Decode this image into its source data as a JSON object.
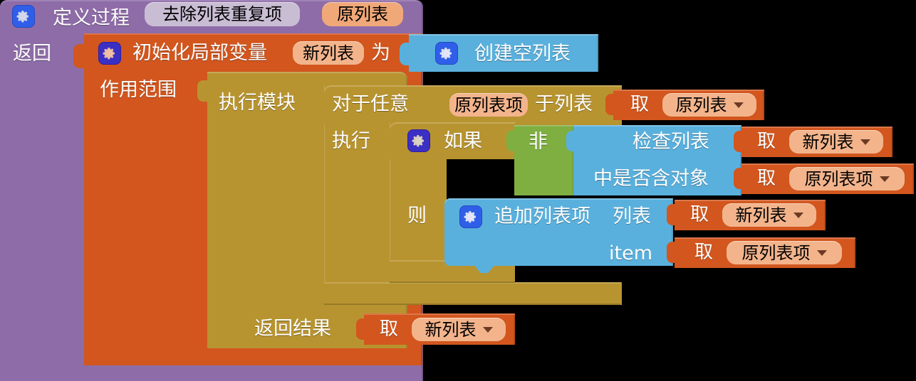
{
  "app": {
    "title": "App Inventor Blocks Editor",
    "canvas_background": "#000000"
  },
  "palette": {
    "procedure_purple": "#8e6ca8",
    "variable_orange": "#d2561e",
    "control_olive": "#b89430",
    "list_blue": "#59b0dd",
    "logic_green": "#7fae41",
    "field_peach": "#f3b48c",
    "field_salmon": "#f0a878",
    "field_lavender": "#c9bdd4",
    "text_white": "#ffffff",
    "text_black": "#000000"
  },
  "blocks": {
    "procedure": {
      "kind": "procedure-definition",
      "label": "定义过程",
      "name_field": "去除列表重复项",
      "param_field": "原列表",
      "return_label": "返回"
    },
    "init_local": {
      "kind": "initialize-local-variable-in-return",
      "label": "初始化局部变量",
      "name_field": "新列表",
      "as_label": "为",
      "scope_label": "作用范围"
    },
    "create_empty_list": {
      "kind": "create-empty-list",
      "label": "创建空列表"
    },
    "do_result": {
      "kind": "do-result",
      "do_label": "执行模块",
      "result_label": "返回结果"
    },
    "for_each": {
      "kind": "for-each-in-list",
      "for_label": "对于任意",
      "item_field": "原列表项",
      "in_list_label": "于列表",
      "do_label": "执行"
    },
    "if_then": {
      "kind": "if-then",
      "if_label": "如果",
      "then_label": "则"
    },
    "not_block": {
      "kind": "logic-not",
      "label": "非"
    },
    "is_in_list": {
      "kind": "is-in-list",
      "line1": "检查列表",
      "line2": "中是否含对象"
    },
    "add_items": {
      "kind": "add-items-to-list",
      "label": "追加列表项",
      "list_label": "列表",
      "item_label": "item"
    }
  },
  "getters": [
    {
      "id": "get-orig-list-foreach",
      "label": "取",
      "variable": "原列表"
    },
    {
      "id": "get-new-list-isinlist",
      "label": "取",
      "variable": "新列表"
    },
    {
      "id": "get-orig-item-isinlist",
      "label": "取",
      "variable": "原列表项"
    },
    {
      "id": "get-new-list-add",
      "label": "取",
      "variable": "新列表"
    },
    {
      "id": "get-orig-item-add",
      "label": "取",
      "variable": "原列表项"
    },
    {
      "id": "get-new-list-result",
      "label": "取",
      "variable": "新列表"
    }
  ]
}
